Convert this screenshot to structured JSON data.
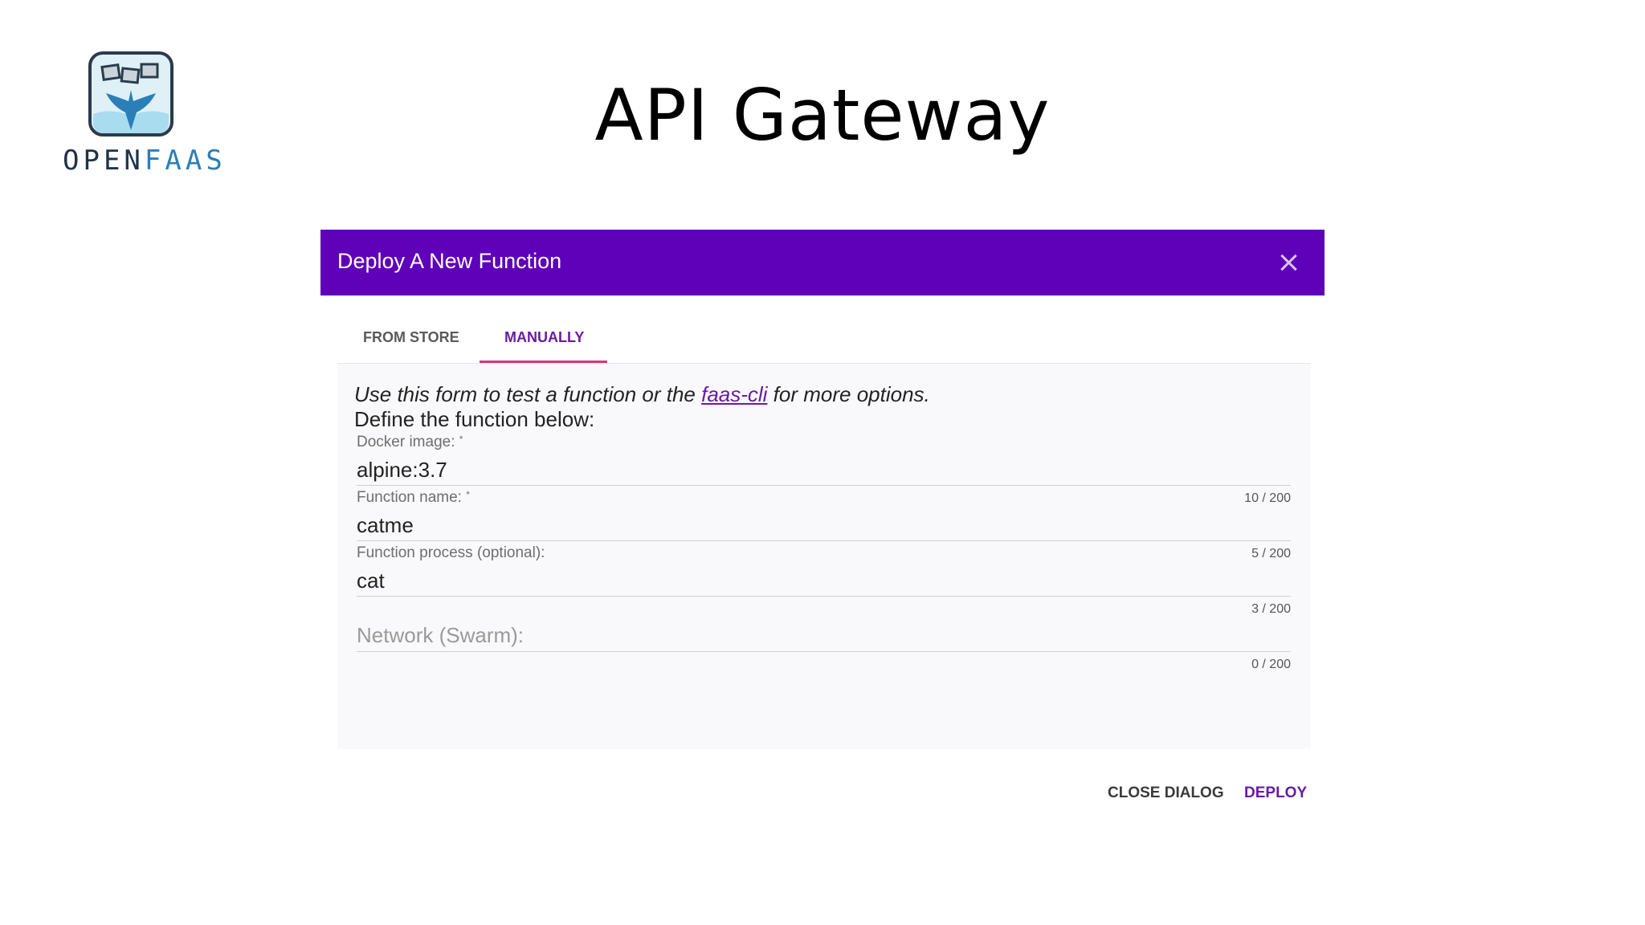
{
  "logo": {
    "part1": "OPEN",
    "part2": "FAAS"
  },
  "slide": {
    "title": "API Gateway"
  },
  "dialog": {
    "title": "Deploy A New Function",
    "header_color": "#5f01b9",
    "tabs": [
      {
        "label": "FROM STORE",
        "active": false
      },
      {
        "label": "MANUALLY",
        "active": true
      }
    ],
    "intro": {
      "before": "Use this form to test a function or the ",
      "link": "faas-cli",
      "after": " for more options."
    },
    "define": "Define the function below:",
    "fields": {
      "docker_image": {
        "label": "Docker image:",
        "required": "*",
        "value": "alpine:3.7",
        "counter": "10 / 200"
      },
      "function_name": {
        "label": "Function name:",
        "required": "*",
        "value": "catme",
        "counter": "5 / 200"
      },
      "function_process": {
        "label": "Function process (optional):",
        "value": "cat",
        "counter": "3 / 200"
      },
      "network": {
        "placeholder": "Network (Swarm):",
        "value": "",
        "counter": "0 / 200"
      }
    },
    "actions": {
      "close": "CLOSE DIALOG",
      "deploy": "DEPLOY"
    }
  }
}
